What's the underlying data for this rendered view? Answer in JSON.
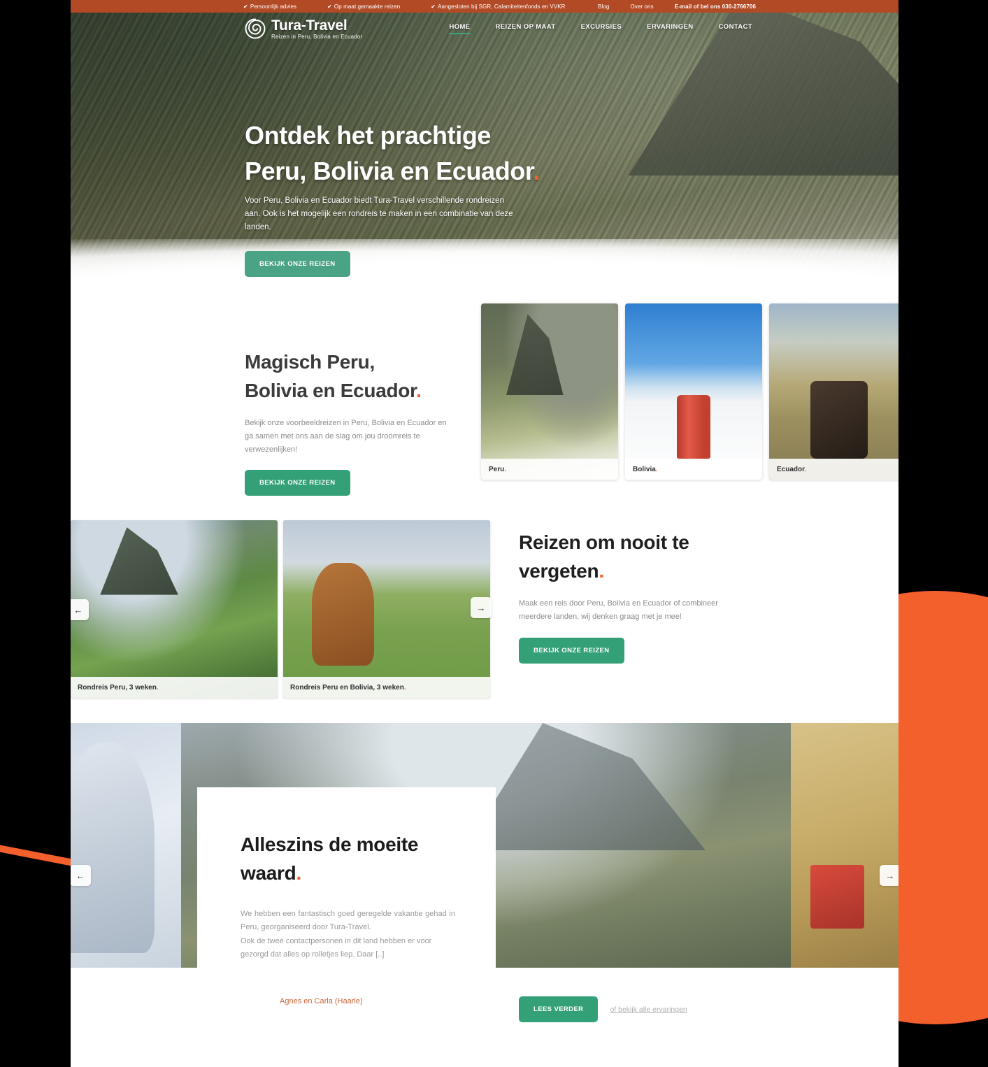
{
  "topbar": {
    "usps": [
      {
        "icon": "check-icon",
        "label": "Persoonlijk advies"
      },
      {
        "icon": "check-icon",
        "label": "Op maat gemaakte reizen"
      },
      {
        "icon": "check-icon",
        "label": "Aangesloten bij SGR, Calamiteitenfonds en VVKR"
      }
    ],
    "links": [
      "Blog",
      "Over ons"
    ],
    "contact": "E-mail of bel ons 030-2766706",
    "bg_color": "#B24A26"
  },
  "header": {
    "logo_name": "Tura-Travel",
    "logo_tagline": "Reizen in Peru, Bolivia en Ecuador",
    "nav": [
      {
        "label": "HOME",
        "active": true
      },
      {
        "label": "REIZEN OP MAAT",
        "active": false
      },
      {
        "label": "EXCURSIES",
        "active": false
      },
      {
        "label": "ERVARINGEN",
        "active": false
      },
      {
        "label": "CONTACT",
        "active": false
      }
    ]
  },
  "hero": {
    "title_line1": "Ontdek het prachtige",
    "title_line2": "Peru, Bolivia en Ecuador",
    "title_dot": ".",
    "paragraph": "Voor Peru, Bolivia en Ecuador biedt Tura-Travel verschillende rondreizen aan. Ook is het mogelijk een rondreis te maken in een combinatie van deze landen.",
    "cta": "BEKIJK ONZE REIZEN"
  },
  "section_magisch": {
    "title_line1": "Magisch Peru,",
    "title_line2": "Bolivia en Ecuador",
    "title_dot": ".",
    "paragraph": "Bekijk onze voorbeeldreizen in Peru, Bolivia en Ecuador en ga samen met ons aan de slag om jou droomreis te verwezenlijken!",
    "cta": "BEKIJK ONZE REIZEN",
    "cards": [
      {
        "caption": "Peru",
        "dot": ".",
        "image": "machu-picchu-couple-photo"
      },
      {
        "caption": "Bolivia",
        "dot": ".",
        "image": "salar-de-uyuni-can-photo"
      },
      {
        "caption": "Ecuador",
        "dot": ".",
        "image": "horse-rider-andes-photo"
      }
    ]
  },
  "section_reizen": {
    "title_line1": "Reizen om nooit te",
    "title_line2": "vergeten",
    "title_dot": ".",
    "paragraph": "Maak een reis door Peru, Bolivia en Ecuador of combineer meerdere landen, wij denken graag met je mee!",
    "cta": "BEKIJK ONZE REIZEN",
    "slides": [
      {
        "caption": "Rondreis Peru, 3 weken",
        "dot": ".",
        "image": "machu-picchu-terraces-photo"
      },
      {
        "caption": "Rondreis Peru en Bolivia, 3 weken",
        "dot": ".",
        "image": "llamas-field-photo"
      }
    ],
    "prev_icon": "arrow-left-icon",
    "next_icon": "arrow-right-icon"
  },
  "testimonial": {
    "title_line1": "Alleszins de moeite",
    "title_line2": "waard",
    "title_dot": ".",
    "quote_line1": "We hebben een fantastisch goed geregelde vakantie gehad in Peru, georganiseerd door Tura-Travel.",
    "quote_line2": "Ook de twee contactpersonen in dit land hebben er voor gezorgd dat alles op rolletjes liep. Daar [..]",
    "author": "Agnes en Carla (Haarle)",
    "cta": "LEES VERDER",
    "secondary_link": "of bekijk alle ervaringen",
    "prev_icon": "arrow-left-icon",
    "next_icon": "arrow-right-icon"
  },
  "theme": {
    "green": "#4AA384",
    "green_solid": "#34A077",
    "orange": "#F4602C",
    "top_bar": "#B24A26",
    "author_orange": "#C8683C"
  }
}
